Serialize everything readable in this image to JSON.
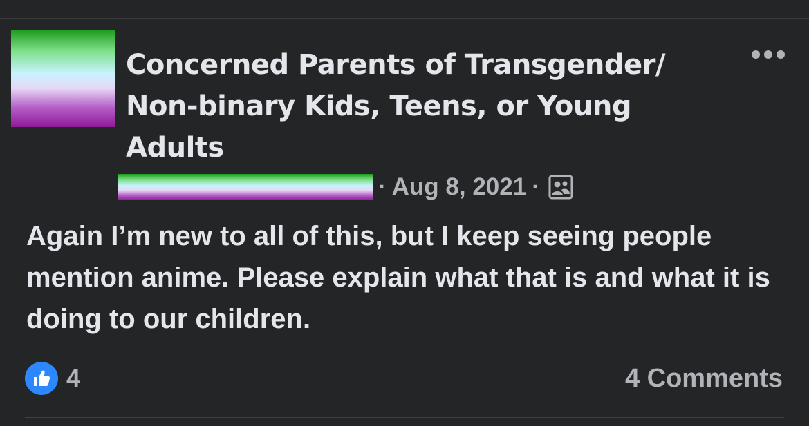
{
  "post": {
    "group_name": "Concerned Parents of Transgender/ Non-binary Kids, Teens, or Young Adults",
    "separator": "·",
    "date": "Aug 8, 2021",
    "body_text": "Again I’m new to all of this, but I keep seeing people mention anime. Please explain what that is and what it is doing to our children.",
    "reaction_count": "4",
    "comments_label": "4 Comments"
  },
  "icons": {
    "more": "more-horizontal-icon",
    "audience": "group-members-icon",
    "like": "thumbs-up-icon"
  },
  "colors": {
    "background": "#242526",
    "primary_text": "#e4e6eb",
    "secondary_text": "#b0b3b8",
    "like_blue": "#2d88ff"
  }
}
